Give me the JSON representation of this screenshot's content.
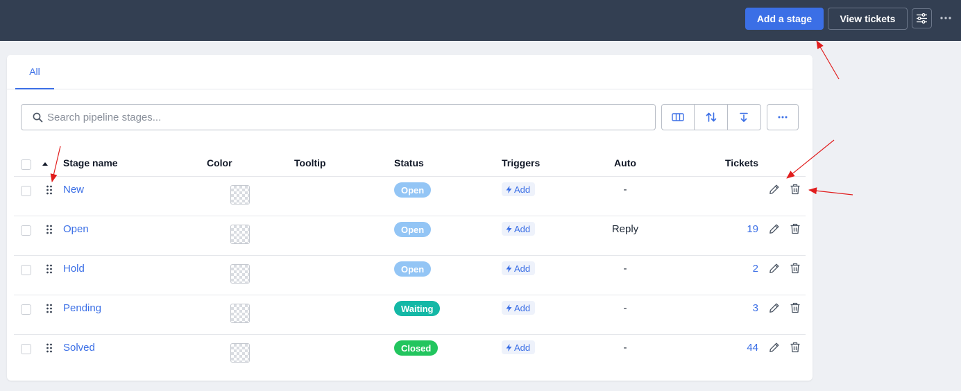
{
  "topbar": {
    "add_stage_label": "Add a stage",
    "view_tickets_label": "View tickets"
  },
  "tabs": [
    {
      "label": "All"
    }
  ],
  "search": {
    "placeholder": "Search pipeline stages..."
  },
  "table": {
    "headers": {
      "stage_name": "Stage name",
      "color": "Color",
      "tooltip": "Tooltip",
      "status": "Status",
      "triggers": "Triggers",
      "auto": "Auto",
      "tickets": "Tickets"
    },
    "rows": [
      {
        "name": "New",
        "tooltip": "",
        "status": "Open",
        "status_color": "#93c5f5",
        "trigger_label": "Add",
        "auto": "-",
        "tickets": ""
      },
      {
        "name": "Open",
        "tooltip": "",
        "status": "Open",
        "status_color": "#93c5f5",
        "trigger_label": "Add",
        "auto": "Reply",
        "tickets": "19"
      },
      {
        "name": "Hold",
        "tooltip": "",
        "status": "Open",
        "status_color": "#93c5f5",
        "trigger_label": "Add",
        "auto": "-",
        "tickets": "2"
      },
      {
        "name": "Pending",
        "tooltip": "",
        "status": "Waiting",
        "status_color": "#14b8a6",
        "trigger_label": "Add",
        "auto": "-",
        "tickets": "3"
      },
      {
        "name": "Solved",
        "tooltip": "",
        "status": "Closed",
        "status_color": "#22c55e",
        "trigger_label": "Add",
        "auto": "-",
        "tickets": "44"
      }
    ]
  },
  "colors": {
    "topbar_bg": "#333f52",
    "accent": "#3b6fe6",
    "annotation_arrow": "#e11d1d"
  }
}
